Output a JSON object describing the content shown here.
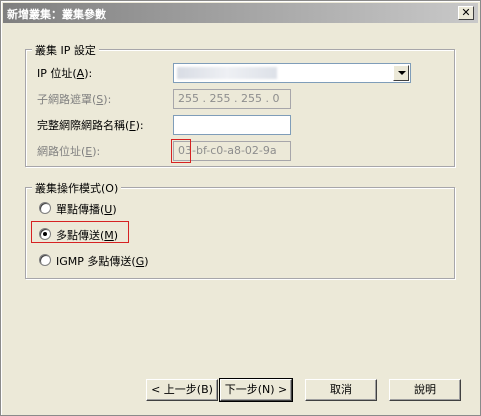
{
  "window": {
    "title": "新增叢集：叢集參數",
    "close": "✕"
  },
  "cluster_ip": {
    "group_label": "叢集 IP 設定",
    "ip_label": "IP 位址(",
    "ip_key": "A",
    "ip_label_end": "):",
    "subnet_label": "子網路遮罩(",
    "subnet_key": "S",
    "subnet_label_end": "):",
    "subnet_value": "255 . 255 . 255 .  0",
    "fqdn_label": "完整網際網路名稱(",
    "fqdn_key": "F",
    "fqdn_label_end": "):",
    "fqdn_value": "",
    "netaddr_label": "網路位址(",
    "netaddr_key": "E",
    "netaddr_label_end": "):",
    "netaddr_prefix": "03",
    "netaddr_rest": "-bf-c0-a8-02-9a"
  },
  "mode": {
    "group_label": "叢集操作模式(O)",
    "options": [
      {
        "label": "單點傳播(",
        "key": "U",
        "end": ")",
        "checked": false
      },
      {
        "label": "多點傳送(",
        "key": "M",
        "end": ")",
        "checked": true
      },
      {
        "label": "IGMP 多點傳送(",
        "key": "G",
        "end": ")",
        "checked": false
      }
    ]
  },
  "buttons": {
    "back": "< 上一步(B)",
    "next": "下一步(N) >",
    "cancel": "取消",
    "help": "說明"
  },
  "colors": {
    "highlight": "#d62222"
  }
}
